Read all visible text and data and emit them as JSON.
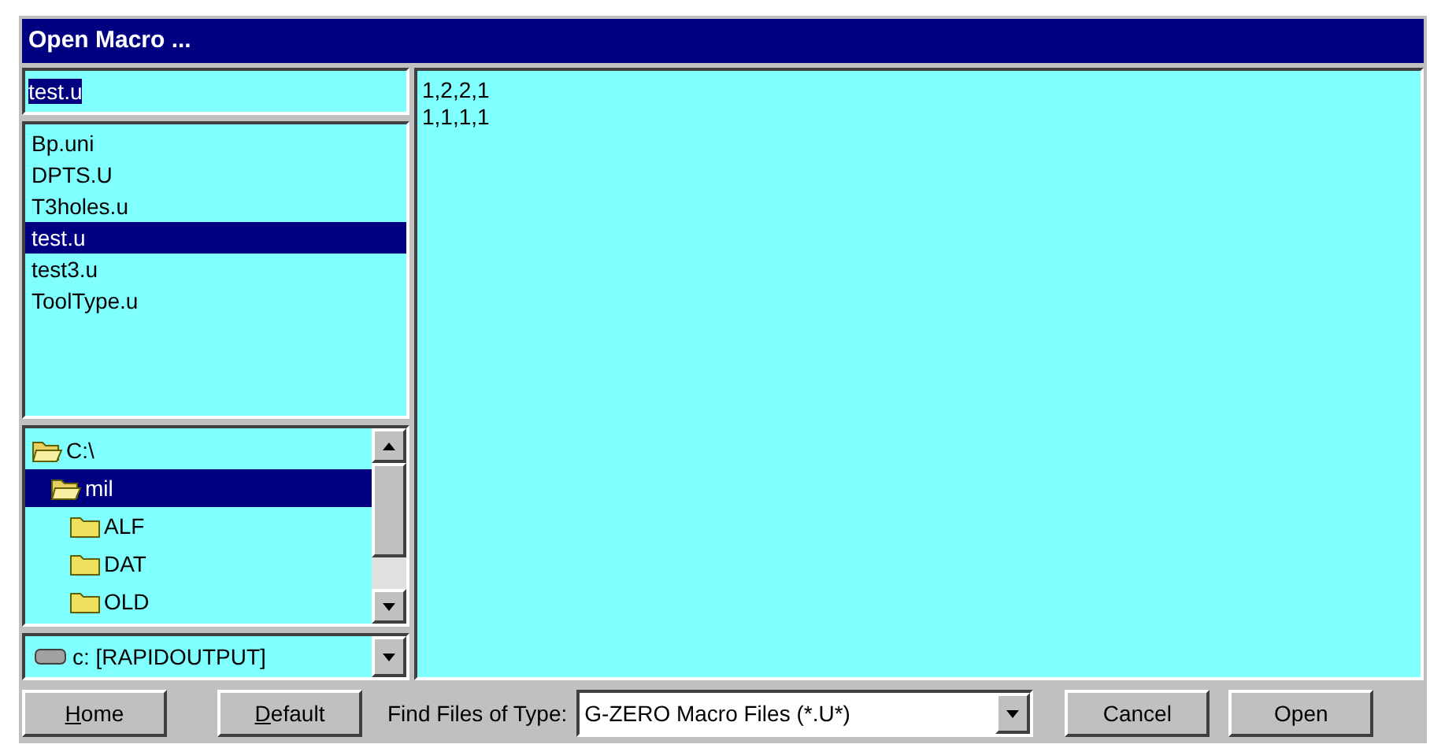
{
  "window": {
    "title": "Open Macro ..."
  },
  "file_name": {
    "value": "test.u"
  },
  "files": [
    {
      "name": "Bp.uni",
      "selected": false
    },
    {
      "name": "DPTS.U",
      "selected": false
    },
    {
      "name": "T3holes.u",
      "selected": false
    },
    {
      "name": "test.u",
      "selected": true
    },
    {
      "name": "test3.u",
      "selected": false
    },
    {
      "name": "ToolType.u",
      "selected": false
    }
  ],
  "directories": [
    {
      "name": "C:\\",
      "open": true,
      "selected": false,
      "children": [
        {
          "name": "mil",
          "open": true,
          "selected": true,
          "children": [
            {
              "name": "ALF",
              "open": false,
              "selected": false
            },
            {
              "name": "DAT",
              "open": false,
              "selected": false
            },
            {
              "name": "OLD",
              "open": false,
              "selected": false
            }
          ]
        }
      ]
    }
  ],
  "drive": {
    "value": "c: [RAPIDOUTPUT]"
  },
  "preview_lines": [
    "1,2,2,1",
    "1,1,1,1"
  ],
  "buttons_left": [
    {
      "label": "Home",
      "first_letter_underlined": true
    },
    {
      "label": "Default",
      "first_letter_underlined": true
    }
  ],
  "file_type": {
    "label": "Find Files of Type:",
    "value": "G-ZERO Macro Files (*.U*)"
  },
  "buttons_right": [
    {
      "label": "Cancel"
    },
    {
      "label": "Open"
    }
  ]
}
